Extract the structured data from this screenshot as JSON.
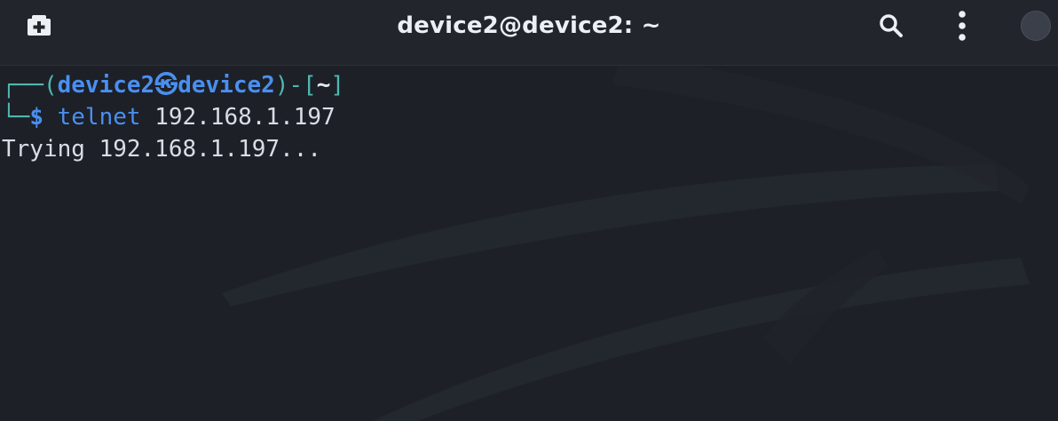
{
  "window": {
    "title": "device2@device2: ~"
  },
  "toolbar": {
    "icons": [
      "new-tab-icon",
      "search-icon",
      "kebab-menu-icon",
      "window-control"
    ]
  },
  "terminal": {
    "prompt": {
      "box_top": "┌──(",
      "user": "device2",
      "at_symbol": "㉿",
      "host": "device2",
      "mid": ")-[",
      "cwd": "~",
      "close": "]",
      "box_bottom": "└─",
      "dollar": "$ "
    },
    "command": {
      "program": "telnet",
      "args": " 192.168.1.197"
    },
    "output": [
      "Trying 192.168.1.197..."
    ]
  },
  "colors": {
    "background": "#1d2027",
    "titlebar": "#22252c",
    "prompt_teal": "#4fb6b0",
    "prompt_blue": "#4a8ff0",
    "text": "#d8dde6"
  }
}
